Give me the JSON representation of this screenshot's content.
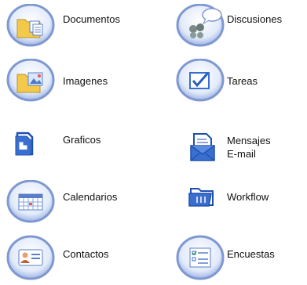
{
  "modules": {
    "documentos": {
      "label": "Documentos",
      "icon": "folder-documents-icon"
    },
    "discusiones": {
      "label": "Discusiones",
      "icon": "discussion-people-icon"
    },
    "imagenes": {
      "label": "Imagenes",
      "icon": "folder-images-icon"
    },
    "tareas": {
      "label": "Tareas",
      "icon": "task-checkbox-icon"
    },
    "graficos": {
      "label": "Graficos",
      "icon": "graphics-chart-icon"
    },
    "mensajes": {
      "label_line1": "Mensajes",
      "label_line2": "E-mail",
      "icon": "email-envelope-icon"
    },
    "calendarios": {
      "label": "Calendarios",
      "icon": "calendar-icon"
    },
    "workflow": {
      "label": "Workflow",
      "icon": "workflow-folder-icon"
    },
    "contactos": {
      "label": "Contactos",
      "icon": "contact-card-icon"
    },
    "encuestas": {
      "label": "Encuestas",
      "icon": "survey-list-icon"
    }
  },
  "colors": {
    "ring_outer": "#8fa8d8",
    "ring_inner": "#dce6f8",
    "icon_blue": "#2b5fc0",
    "folder_yellow": "#f3c94a"
  }
}
